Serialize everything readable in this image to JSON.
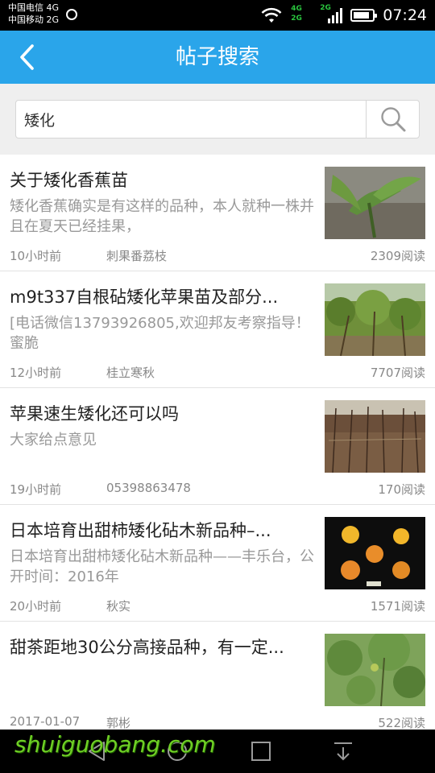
{
  "status_bar": {
    "carrier_1": "中国电信 4G",
    "carrier_2": "中国移动 2G",
    "net_4g": "4G",
    "net_2g_a": "2G",
    "net_2g_b": "2G",
    "battery_level": 0.85,
    "time": "07:24"
  },
  "header": {
    "title": "帖子搜索",
    "back_icon": "chevron-left-icon",
    "bg_color": "#2aa5ea"
  },
  "search": {
    "value": "矮化",
    "icon": "search-icon"
  },
  "posts": [
    {
      "title": "关于矮化香蕉苗",
      "excerpt": "矮化香蕉确实是有这样的品种，本人就种一株并且在夏天已经挂果，",
      "time": "10小时前",
      "author": "刺果番荔枝",
      "reads": "2309阅读"
    },
    {
      "title": "m9t337自根砧矮化苹果苗及部分...",
      "excerpt": "[电话微信13793926805,欢迎邦友考察指导！ 蜜脆",
      "time": "12小时前",
      "author": "桂立寒秋",
      "reads": "7707阅读"
    },
    {
      "title": "苹果速生矮化还可以吗",
      "excerpt": "大家给点意见",
      "time": "19小时前",
      "author": "05398863478",
      "reads": "170阅读"
    },
    {
      "title": "日本培育出甜柿矮化砧木新品种–...",
      "excerpt": "日本培育出甜柿矮化砧木新品种——丰乐台，公开时间：2016年",
      "time": "20小时前",
      "author": "秋实",
      "reads": "1571阅读"
    },
    {
      "title": "甜茶距地30公分高接品种，有一定...",
      "excerpt": "",
      "time": "2017-01-07",
      "author": "郭彬",
      "reads": "522阅读"
    }
  ],
  "watermark": "shuiguobang.com",
  "nav": {
    "back_icon": "nav-back-icon",
    "home_icon": "nav-home-icon",
    "recents_icon": "nav-recents-icon",
    "menu_icon": "nav-dropdown-icon"
  }
}
